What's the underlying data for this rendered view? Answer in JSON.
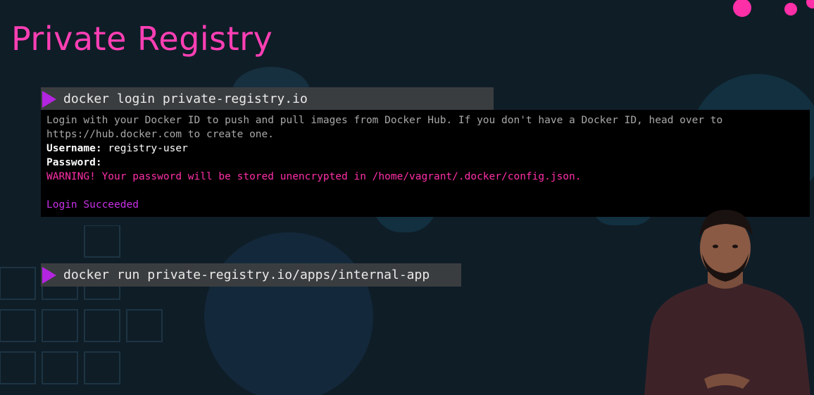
{
  "slide": {
    "title": "Private Registry"
  },
  "commands": {
    "login": "docker login private-registry.io",
    "run": "docker run private-registry.io/apps/internal-app"
  },
  "terminal": {
    "info_line_1": "Login with your Docker ID to push and pull images from Docker Hub. If you don't have a Docker ID, head over to",
    "info_line_2": "https://hub.docker.com to create one.",
    "username_label": "Username:",
    "username_value": "registry-user",
    "password_label": "Password:",
    "warning": "WARNING! Your password will be stored unencrypted in /home/vagrant/.docker/config.json.",
    "result": "Login Succeeded"
  },
  "colors": {
    "background": "#0f1d27",
    "accent_pink": "#ff3fb4",
    "prompt_purple": "#b325e0",
    "command_bar": "#3a3d3f",
    "warning_pink": "#ff2fa8",
    "success_purple": "#c930e8"
  },
  "icons": {
    "prompt": "triangle-play-icon"
  }
}
